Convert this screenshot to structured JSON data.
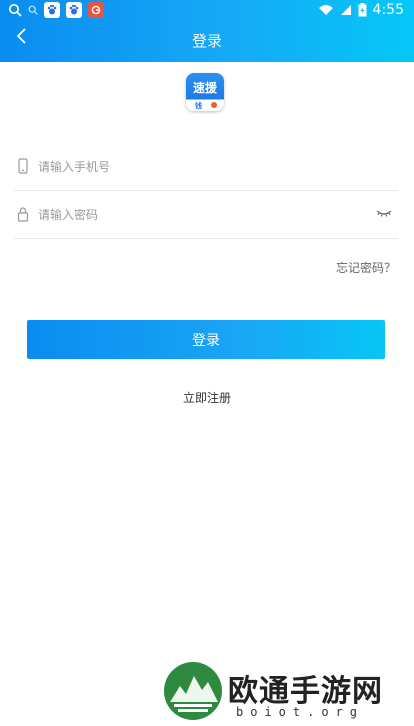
{
  "status_bar": {
    "time": "4:55",
    "icons": [
      "search-icon",
      "search-small-icon",
      "baidu-app-icon",
      "baidu-app-icon",
      "browser-app-icon",
      "wifi-icon",
      "signal-icon",
      "battery-charging-icon"
    ]
  },
  "header": {
    "title": "登录",
    "back_icon": "chevron-left-icon"
  },
  "logo": {
    "text": "速援",
    "sub": "钱"
  },
  "form": {
    "phone_placeholder": "请输入手机号",
    "password_placeholder": "请输入密码",
    "forgot_link": "忘记密码？",
    "login_button": "登录",
    "register_link": "立即注册"
  },
  "watermark": {
    "text_cn": "欧通手游网",
    "text_en": "boiot.org"
  },
  "colors": {
    "header_start": "#0a8cf0",
    "header_end": "#05c7f7",
    "button_start": "#0a8cf0",
    "button_end": "#07c6f6",
    "background": "#ffffff"
  }
}
